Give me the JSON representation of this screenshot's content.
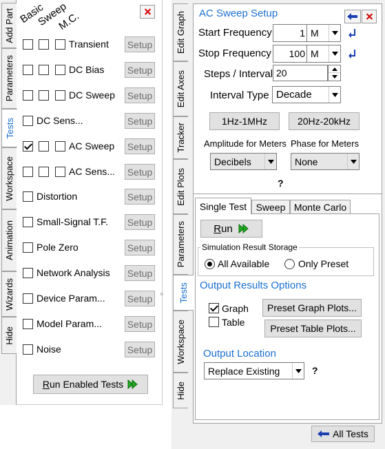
{
  "left_panel": {
    "tabs": [
      "Add Part",
      "Parameters",
      "Tests",
      "Workspace",
      "Animation",
      "Wizards",
      "Hide"
    ],
    "active_tab": "Tests",
    "column_headers": [
      "Basic",
      "Sweep",
      "M.C."
    ],
    "tests": [
      {
        "label": "Transient",
        "boxes": 3,
        "checked": [
          false,
          false,
          false
        ],
        "setup": "Setup"
      },
      {
        "label": "DC Bias",
        "boxes": 3,
        "checked": [
          false,
          false,
          false
        ],
        "setup": "Setup"
      },
      {
        "label": "DC Sweep",
        "boxes": 3,
        "checked": [
          false,
          false,
          false
        ],
        "setup": "Setup"
      },
      {
        "label": "DC Sens...",
        "boxes": 1,
        "checked": [
          false
        ],
        "setup": "Setup"
      },
      {
        "label": "AC Sweep",
        "boxes": 3,
        "checked": [
          true,
          false,
          false
        ],
        "setup": "Setup"
      },
      {
        "label": "AC Sens...",
        "boxes": 3,
        "checked": [
          false,
          false,
          false
        ],
        "setup": "Setup"
      },
      {
        "label": "Distortion",
        "boxes": 1,
        "checked": [
          false
        ],
        "setup": "Setup"
      },
      {
        "label": "Small-Signal T.F.",
        "boxes": 1,
        "checked": [
          false
        ],
        "setup": "Setup"
      },
      {
        "label": "Pole Zero",
        "boxes": 1,
        "checked": [
          false
        ],
        "setup": "Setup"
      },
      {
        "label": "Network  Analysis",
        "boxes": 1,
        "checked": [
          false
        ],
        "setup": "Setup"
      },
      {
        "label": "Device Param...",
        "boxes": 1,
        "checked": [
          false
        ],
        "setup": "Setup"
      },
      {
        "label": "Model  Param...",
        "boxes": 1,
        "checked": [
          false
        ],
        "setup": "Setup"
      },
      {
        "label": "Noise",
        "boxes": 1,
        "checked": [
          false
        ],
        "setup": "Setup"
      }
    ],
    "run_button": {
      "mnemonic": "R",
      "rest": "un Enabled Tests"
    }
  },
  "right_panel": {
    "tabs": [
      "Edit Graph",
      "Edit Axes",
      "Tracker",
      "Edit Plots",
      "Parameters",
      "Tests",
      "Workspace",
      "Hide"
    ],
    "active_tab": "Tests",
    "title": "AC Sweep Setup",
    "start_frequency": {
      "label": "Start Frequency",
      "value": "1",
      "unit": "M"
    },
    "stop_frequency": {
      "label": "Stop Frequency",
      "value": "100",
      "unit": "M"
    },
    "steps": {
      "label": "Steps / Interval",
      "value": "20"
    },
    "interval_type": {
      "label": "Interval Type",
      "value": "Decade"
    },
    "presets": [
      "1Hz-1MHz",
      "20Hz-20kHz"
    ],
    "amplitude": {
      "label": "Amplitude for Meters",
      "value": "Decibels"
    },
    "phase": {
      "label": "Phase for Meters",
      "value": "None"
    },
    "help": "?",
    "subtabs": [
      "Single Test",
      "Sweep",
      "Monte Carlo"
    ],
    "active_subtab": "Single Test",
    "run": {
      "mnemonic": "R",
      "rest": "un"
    },
    "storage": {
      "legend": "Simulation Result Storage",
      "options": [
        "All Available",
        "Only Preset"
      ],
      "selected": "All Available"
    },
    "output_results": {
      "heading": "Output Results Options",
      "graph": {
        "label": "Graph",
        "checked": true
      },
      "table": {
        "label": "Table",
        "checked": false
      },
      "preset_graph": "Preset Graph Plots...",
      "preset_table": "Preset Table Plots..."
    },
    "output_location": {
      "heading": "Output Location",
      "value": "Replace Existing",
      "help": "?"
    },
    "all_tests": "All Tests"
  },
  "icons": {
    "close": "close-icon",
    "run": "double-play-icon",
    "return": "enter-return-icon",
    "back": "back-arrow-icon",
    "spin": "spinner-icon",
    "dropdown": "chevron-down-icon"
  },
  "colors": {
    "accent_blue": "#1a6fd0",
    "run_green": "#1ea81e",
    "close_red": "#d40000"
  }
}
